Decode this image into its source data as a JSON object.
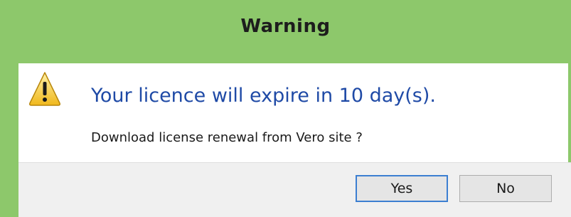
{
  "dialog": {
    "title": "Warning",
    "icon": "warning-icon",
    "main_instruction": "Your licence will expire in 10 day(s).",
    "content": "Download license renewal from Vero site ?",
    "buttons": {
      "yes_label": "Yes",
      "no_label": "No"
    },
    "colors": {
      "frame": "#8dc86b",
      "instruction_text": "#1f4aa6",
      "default_button_border": "#3c7fd1"
    }
  }
}
